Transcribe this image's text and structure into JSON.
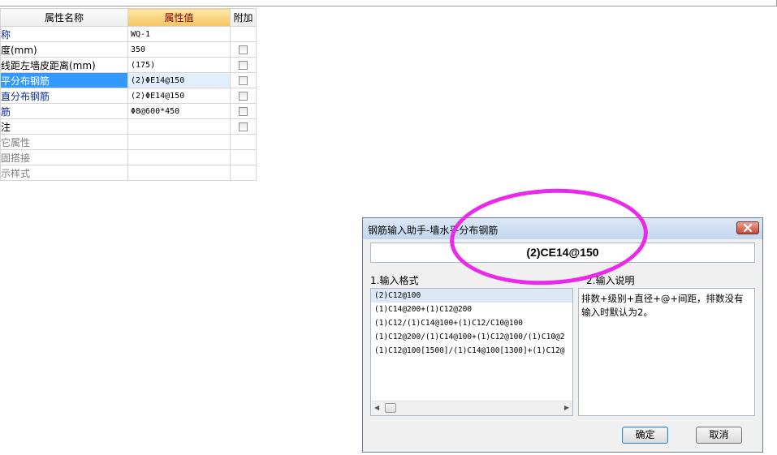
{
  "property_grid": {
    "headers": {
      "name": "属性名称",
      "value": "属性值",
      "extra": "附加"
    },
    "rows": [
      {
        "name": "称",
        "value": "WQ-1",
        "checkbox": false
      },
      {
        "name": "度(mm)",
        "value": "350",
        "checkbox": true
      },
      {
        "name": "线距左墙皮距离(mm)",
        "value": "(175)",
        "checkbox": true
      },
      {
        "name": "平分布钢筋",
        "value": "(2)ΦE14@150",
        "checkbox": true
      },
      {
        "name": "直分布钢筋",
        "value": "(2)ΦE14@150",
        "checkbox": true
      },
      {
        "name": "筋",
        "value": "Φ8@600*450",
        "checkbox": true
      },
      {
        "name": "注",
        "value": "",
        "checkbox": true
      },
      {
        "name": "它属性",
        "value": "",
        "checkbox": false
      },
      {
        "name": "固搭接",
        "value": "",
        "checkbox": false
      },
      {
        "name": "示样式",
        "value": "",
        "checkbox": false
      }
    ]
  },
  "dialog": {
    "title": "钢筋输入助手-墙水平分布钢筋",
    "result_value": "(2)CE14@150",
    "format_label": "1.输入格式",
    "explain_label": "2.输入说明",
    "formats": [
      "(2)C12@100",
      "(1)C14@200+(1)C12@200",
      "(1)C12/(1)C14@100+(1)C12/C10@100",
      "(1)C12@200/(1)C14@100+(1)C12@100/(1)C10@2",
      "(1)C12@100[1500]/(1)C14@100[1300]+(1)C12@"
    ],
    "explanation": "排数+级别+直径+@+间距，排数没有输入时默认为2。",
    "ok_label": "确定",
    "cancel_label": "取消"
  },
  "colors": {
    "selection": "#3399ff",
    "annotation_ellipse": "#ea29ea",
    "header_value_bg": "#f6c55e"
  }
}
